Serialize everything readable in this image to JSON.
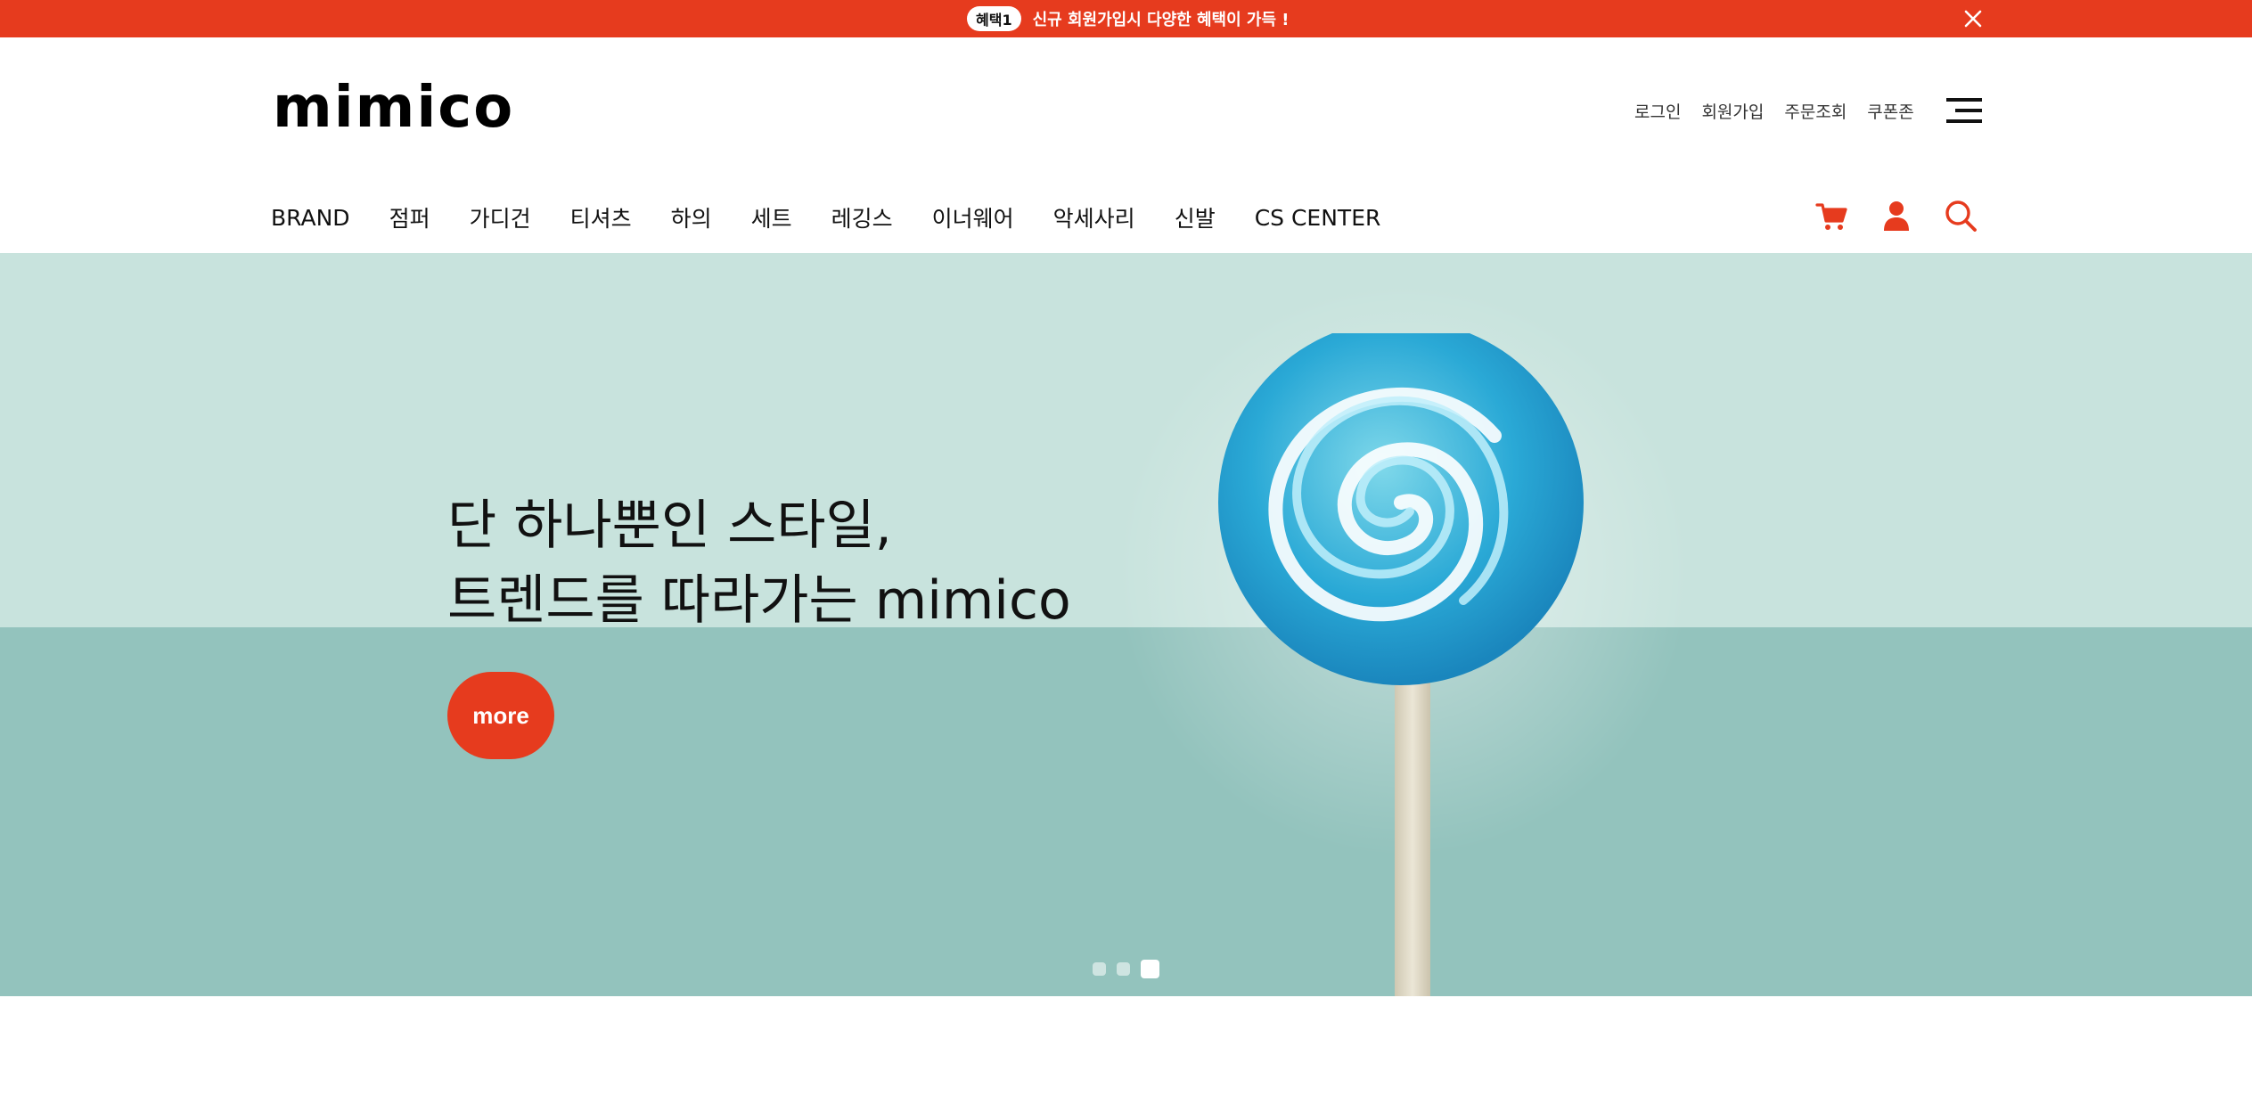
{
  "promo": {
    "badge": "혜택1",
    "text": "신규 회원가입시 다양한 혜택이 가득 !",
    "close_icon": "close-icon",
    "bg_color": "#e63b1e"
  },
  "header": {
    "logo": "mimico",
    "util_links": [
      "로그인",
      "회원가입",
      "주문조회",
      "쿠폰존"
    ],
    "menu_icon": "hamburger-menu-icon"
  },
  "nav": {
    "items": [
      "BRAND",
      "점퍼",
      "가디건",
      "티셔츠",
      "하의",
      "세트",
      "레깅스",
      "이너웨어",
      "악세사리",
      "신발",
      "CS CENTER"
    ],
    "icons": [
      "cart-icon",
      "user-icon",
      "search-icon"
    ],
    "accent_color": "#e63b1e"
  },
  "hero": {
    "line1": "단 하나뿐인 스타일,",
    "line2": "트렌드를 따라가는 mimico",
    "button": "more",
    "slide_count": 3,
    "active_slide": 3,
    "top_color": "#c8e3dd",
    "bottom_color": "#93c3bd"
  }
}
